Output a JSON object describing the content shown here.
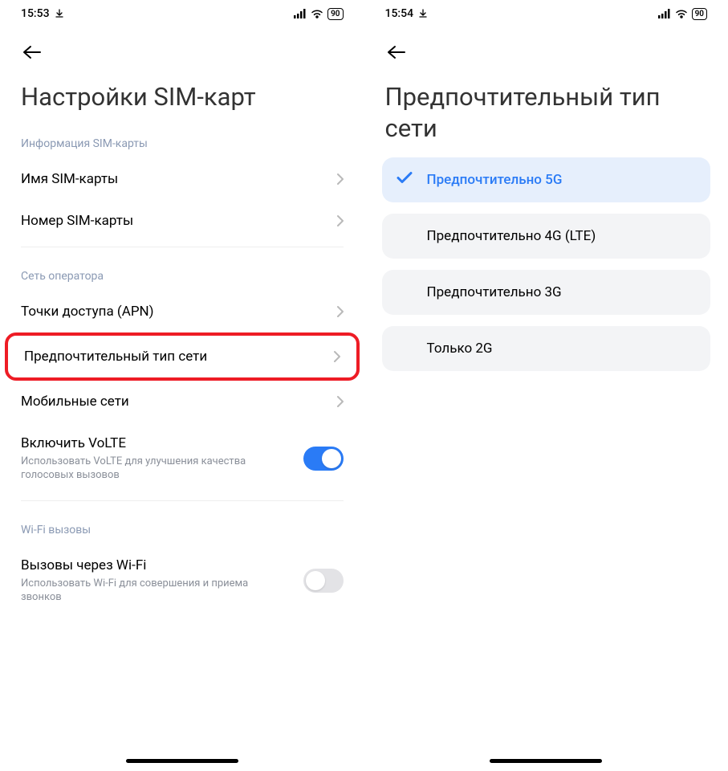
{
  "left": {
    "status": {
      "time": "15:53",
      "battery": "90"
    },
    "title": "Настройки SIM-карт",
    "section_sim_info": "Информация SIM-карты",
    "row_sim_name": {
      "label": "Имя SIM-карты",
      "value": "        "
    },
    "row_sim_number": {
      "label": "Номер SIM-карты",
      "value": "                    "
    },
    "section_operator": "Сеть оператора",
    "row_apn": {
      "label": "Точки доступа (APN)"
    },
    "row_pref_net": {
      "label": "Предпочтительный тип сети"
    },
    "row_mobile_net": {
      "label": "Мобильные сети"
    },
    "row_volte": {
      "label": "Включить VoLTE",
      "sub": "Использовать VoLTE для улучшения качества голосовых вызовов",
      "on": true
    },
    "section_wifi_calls": "Wi-Fi вызовы",
    "row_wifi_call": {
      "label": "Вызовы через Wi-Fi",
      "sub": "Использовать Wi-Fi для совершения и приема звонков",
      "on": false
    }
  },
  "right": {
    "status": {
      "time": "15:54",
      "battery": "90"
    },
    "title": "Предпочтительный тип сети",
    "options": {
      "opt0": "Предпочтительно 5G",
      "opt1": "Предпочтительно 4G (LTE)",
      "opt2": "Предпочтительно 3G",
      "opt3": "Только 2G"
    }
  }
}
